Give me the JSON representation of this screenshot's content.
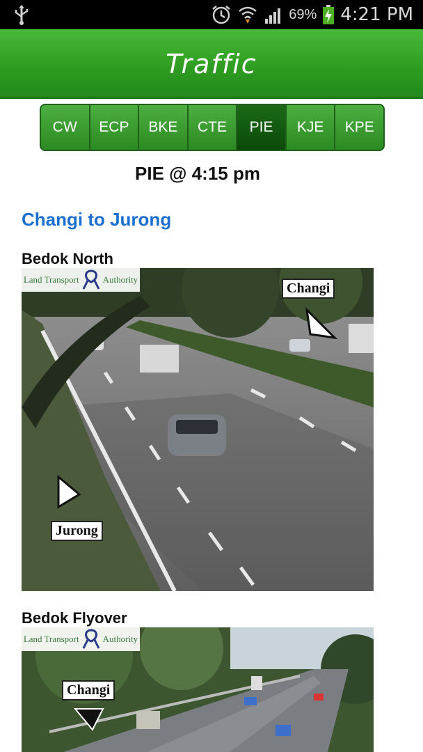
{
  "status_bar": {
    "battery_percent": "69%",
    "time": "4:21 PM"
  },
  "app_bar": {
    "title": "Traffic"
  },
  "tabs": [
    {
      "label": "CW",
      "active": false
    },
    {
      "label": "ECP",
      "active": false
    },
    {
      "label": "BKE",
      "active": false
    },
    {
      "label": "CTE",
      "active": false
    },
    {
      "label": "PIE",
      "active": true
    },
    {
      "label": "KJE",
      "active": false
    },
    {
      "label": "KPE",
      "active": false
    }
  ],
  "headline": "PIE @ 4:15 pm",
  "section": {
    "title": "Changi to Jurong"
  },
  "cameras": [
    {
      "name": "Bedok North",
      "logo_text_left": "Land Transport",
      "logo_text_right": "Authority",
      "sign_top": "Changi",
      "sign_bottom": "Jurong"
    },
    {
      "name": "Bedok Flyover",
      "logo_text_left": "Land Transport",
      "logo_text_right": "Authority",
      "sign_top": "Changi"
    }
  ],
  "colors": {
    "accent": "#2f9d21",
    "active_tab": "#0b4a08",
    "link_blue": "#1a6fd1"
  }
}
